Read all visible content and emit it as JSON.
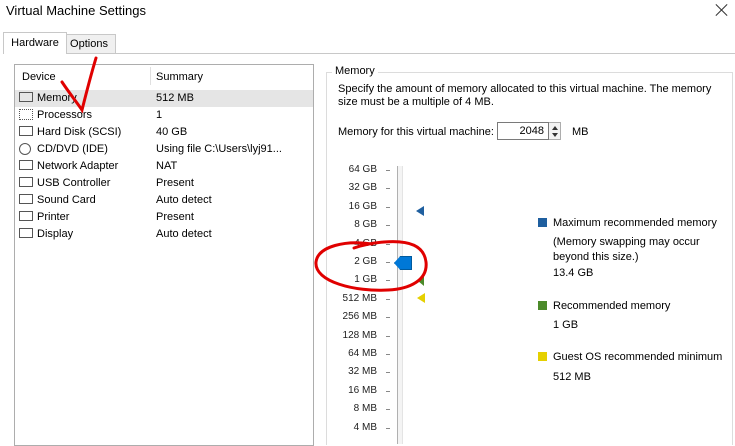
{
  "window": {
    "title": "Virtual Machine Settings"
  },
  "tabs": [
    {
      "label": "Hardware",
      "active": true
    },
    {
      "label": "Options",
      "active": false
    }
  ],
  "device_list": {
    "headers": {
      "device": "Device",
      "summary": "Summary"
    },
    "selected_index": 0,
    "items": [
      {
        "name": "Memory",
        "summary": "512 MB",
        "icon": "memory-icon"
      },
      {
        "name": "Processors",
        "summary": "1",
        "icon": "cpu-icon"
      },
      {
        "name": "Hard Disk (SCSI)",
        "summary": "40 GB",
        "icon": "harddisk-icon"
      },
      {
        "name": "CD/DVD (IDE)",
        "summary": "Using file C:\\Users\\lyj91...",
        "icon": "cd-icon"
      },
      {
        "name": "Network Adapter",
        "summary": "NAT",
        "icon": "network-icon"
      },
      {
        "name": "USB Controller",
        "summary": "Present",
        "icon": "usb-icon"
      },
      {
        "name": "Sound Card",
        "summary": "Auto detect",
        "icon": "sound-icon"
      },
      {
        "name": "Printer",
        "summary": "Present",
        "icon": "printer-icon"
      },
      {
        "name": "Display",
        "summary": "Auto detect",
        "icon": "display-icon"
      }
    ]
  },
  "memory": {
    "group_title": "Memory",
    "description": "Specify the amount of memory allocated to this virtual machine. The memory size must be a multiple of 4 MB.",
    "input_label": "Memory for this virtual machine:",
    "value": "2048",
    "unit": "MB",
    "scale_labels": [
      "64 GB",
      "32 GB",
      "16 GB",
      "8 GB",
      "4 GB",
      "2 GB",
      "1 GB",
      "512 MB",
      "256 MB",
      "128 MB",
      "64 MB",
      "32 MB",
      "16 MB",
      "8 MB",
      "4 MB"
    ],
    "legend": {
      "max_title": "Maximum recommended memory",
      "max_note": "(Memory swapping may occur beyond this size.)",
      "max_value": "13.4 GB",
      "rec_title": "Recommended memory",
      "rec_value": "1 GB",
      "guest_title": "Guest OS recommended minimum",
      "guest_value": "512 MB"
    },
    "colors": {
      "max": "#1f5f9f",
      "recommended": "#4c8a2a",
      "guest": "#e5d000",
      "thumb": "#0078d7",
      "annotation": "#e00000"
    }
  }
}
